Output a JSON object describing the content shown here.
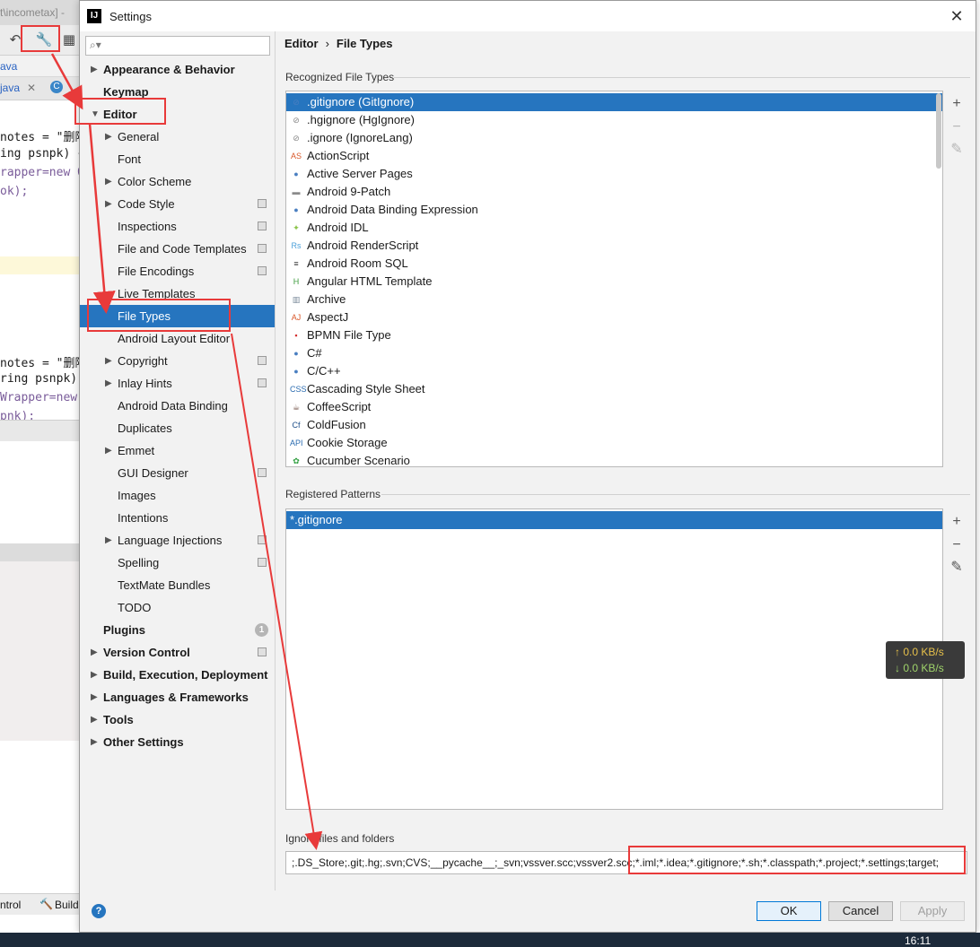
{
  "ide": {
    "title": "t\\incometax] -",
    "crumb": "ava",
    "tab_file": "java",
    "tab_file2": "C",
    "code": [
      {
        "text": "notes = \"删除"
      },
      {
        "text": "ing psnpk) {"
      },
      {
        "text": "rapper=new Qu"
      },
      {
        "text": "ok);"
      },
      {
        "text": "notes = \"删除"
      },
      {
        "text": "ring psnpk)"
      },
      {
        "text": "Wrapper=new"
      },
      {
        "text": "pnk);"
      }
    ],
    "bottom_left": "ntrol",
    "bottom_build": "Build"
  },
  "dialog": {
    "title": "Settings",
    "app_icon": "IJ",
    "close_glyph": "✕"
  },
  "nav": {
    "search_placeholder": "",
    "items": [
      {
        "label": "Appearance & Behavior"
      },
      {
        "label": "Keymap"
      },
      {
        "label": "Editor"
      },
      {
        "label": "General"
      },
      {
        "label": "Font"
      },
      {
        "label": "Color Scheme"
      },
      {
        "label": "Code Style"
      },
      {
        "label": "Inspections"
      },
      {
        "label": "File and Code Templates"
      },
      {
        "label": "File Encodings"
      },
      {
        "label": "Live Templates"
      },
      {
        "label": "File Types"
      },
      {
        "label": "Android Layout Editor"
      },
      {
        "label": "Copyright"
      },
      {
        "label": "Inlay Hints"
      },
      {
        "label": "Android Data Binding"
      },
      {
        "label": "Duplicates"
      },
      {
        "label": "Emmet"
      },
      {
        "label": "GUI Designer"
      },
      {
        "label": "Images"
      },
      {
        "label": "Intentions"
      },
      {
        "label": "Language Injections"
      },
      {
        "label": "Spelling"
      },
      {
        "label": "TextMate Bundles"
      },
      {
        "label": "TODO"
      },
      {
        "label": "Plugins",
        "badge": "1"
      },
      {
        "label": "Version Control"
      },
      {
        "label": "Build, Execution, Deployment"
      },
      {
        "label": "Languages & Frameworks"
      },
      {
        "label": "Tools"
      },
      {
        "label": "Other Settings"
      }
    ]
  },
  "content": {
    "breadcrumb_parent": "Editor",
    "breadcrumb_sep": "›",
    "breadcrumb_current": "File Types",
    "recognized_label": "Recognized File Types",
    "file_types": [
      {
        "name": ".gitignore (GitIgnore)",
        "icon": "git-icon",
        "glyph": "⊘",
        "color": "#4a7fc1"
      },
      {
        "name": ".hgignore (HgIgnore)",
        "icon": "hg-icon",
        "glyph": "⊘",
        "color": "#888888"
      },
      {
        "name": ".ignore (IgnoreLang)",
        "icon": "ignore-icon",
        "glyph": "⊘",
        "color": "#888888"
      },
      {
        "name": "ActionScript",
        "icon": "actionscript-icon",
        "glyph": "AS",
        "color": "#d9592c"
      },
      {
        "name": "Active Server Pages",
        "icon": "asp-icon",
        "glyph": "●",
        "color": "#4a7fc1"
      },
      {
        "name": "Android 9-Patch",
        "icon": "folder-icon",
        "glyph": "▬",
        "color": "#8a8a8a"
      },
      {
        "name": "Android Data Binding Expression",
        "icon": "binding-icon",
        "glyph": "●",
        "color": "#4a7fc1"
      },
      {
        "name": "Android IDL",
        "icon": "android-icon",
        "glyph": "✦",
        "color": "#8bc34a"
      },
      {
        "name": "Android RenderScript",
        "icon": "renderscript-icon",
        "glyph": "Rs",
        "color": "#4a9fd9"
      },
      {
        "name": "Android Room SQL",
        "icon": "database-icon",
        "glyph": "≡",
        "color": "#333333"
      },
      {
        "name": "Angular HTML Template",
        "icon": "angular-icon",
        "glyph": "H",
        "color": "#3c9a3c"
      },
      {
        "name": "Archive",
        "icon": "archive-icon",
        "glyph": "▥",
        "color": "#7a8a9a"
      },
      {
        "name": "AspectJ",
        "icon": "aspectj-icon",
        "glyph": "AJ",
        "color": "#d9592c"
      },
      {
        "name": "BPMN File Type",
        "icon": "bpmn-icon",
        "glyph": "▪",
        "color": "#d32f2f"
      },
      {
        "name": "C#",
        "icon": "csharp-icon",
        "glyph": "●",
        "color": "#4a7fc1"
      },
      {
        "name": "C/C++",
        "icon": "cpp-icon",
        "glyph": "●",
        "color": "#4a7fc1"
      },
      {
        "name": "Cascading Style Sheet",
        "icon": "css-icon",
        "glyph": "CSS",
        "color": "#2b6cb0"
      },
      {
        "name": "CoffeeScript",
        "icon": "coffee-icon",
        "glyph": "☕",
        "color": "#6d4c41"
      },
      {
        "name": "ColdFusion",
        "icon": "coldfusion-icon",
        "glyph": "Cf",
        "color": "#1d4e89"
      },
      {
        "name": "Cookie Storage",
        "icon": "api-icon",
        "glyph": "API",
        "color": "#2b6cb0"
      },
      {
        "name": "Cucumber Scenario",
        "icon": "cucumber-icon",
        "glyph": "✿",
        "color": "#2e9e3e"
      }
    ],
    "registered_label": "Registered Patterns",
    "patterns": [
      ".gitignore"
    ],
    "pattern_prefix": "*",
    "ignore_label": "Ignore files and folders",
    "ignore_value": ";.DS_Store;.git;.hg;.svn;CVS;__pycache__;_svn;vssver.scc;vssver2.scc;*.iml;*.idea;*.gitignore;*.sh;*.classpath;*.project;*.settings;target;",
    "net_up": "↑ 0.0 KB/s",
    "net_down": "↓ 0.0 KB/s"
  },
  "tools": {
    "add": "+",
    "remove": "−",
    "edit": "✎"
  },
  "footer": {
    "help": "?",
    "ok": "OK",
    "cancel": "Cancel",
    "apply": "Apply"
  },
  "taskbar": {
    "clock": "16:11"
  },
  "colors": {
    "accent": "#2675bf",
    "annotation": "#e83a3a"
  }
}
